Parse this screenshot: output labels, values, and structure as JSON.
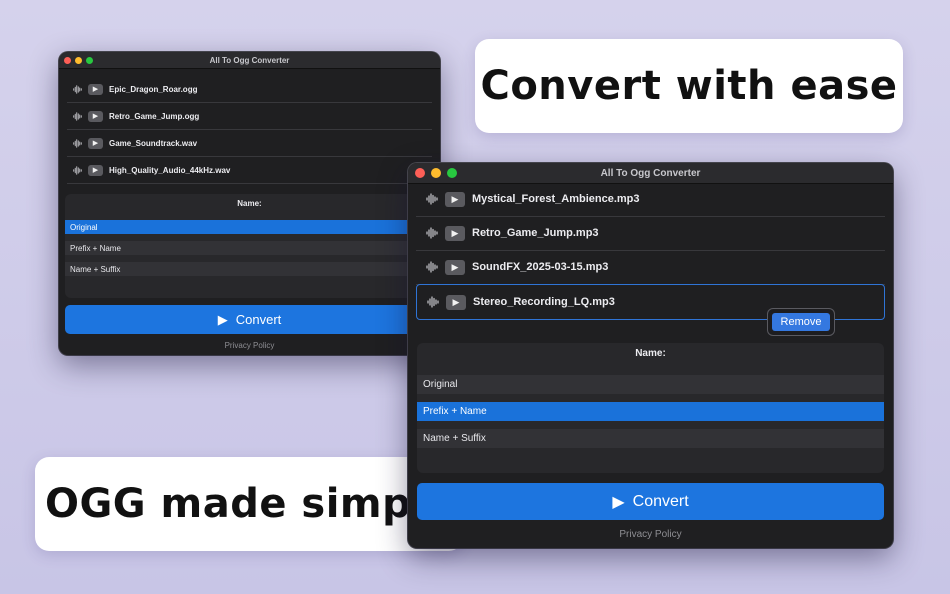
{
  "callouts": {
    "top": "Convert with ease",
    "bottom": "OGG made simple"
  },
  "window_back": {
    "title": "All To Ogg Converter",
    "files": [
      "Epic_Dragon_Roar.ogg",
      "Retro_Game_Jump.ogg",
      "Game_Soundtrack.wav",
      "High_Quality_Audio_44kHz.wav"
    ],
    "name_header": "Name:",
    "options": [
      "Original",
      "Prefix + Name",
      "Name + Suffix"
    ],
    "selected_option": "Original",
    "convert_label": "Convert",
    "privacy_label": "Privacy Policy"
  },
  "window_front": {
    "title": "All To Ogg Converter",
    "files": [
      "Mystical_Forest_Ambience.mp3",
      "Retro_Game_Jump.mp3",
      "SoundFX_2025-03-15.mp3",
      "Stereo_Recording_LQ.mp3"
    ],
    "highlighted_file": "Stereo_Recording_LQ.mp3",
    "context_menu_label": "Remove",
    "name_header": "Name:",
    "options": [
      "Original",
      "Prefix + Name",
      "Name + Suffix"
    ],
    "selected_option": "Prefix + Name",
    "convert_label": "Convert",
    "privacy_label": "Privacy Policy"
  },
  "icons": {
    "waveform": "waveform-icon",
    "play": "play-icon",
    "close": "close-window-dot",
    "minimize": "minimize-window-dot",
    "zoom": "zoom-window-dot"
  },
  "colors": {
    "background": "#d5d2ec",
    "window": "#1f1f21",
    "accent": "#1d75df",
    "selection": "#1a72da"
  }
}
